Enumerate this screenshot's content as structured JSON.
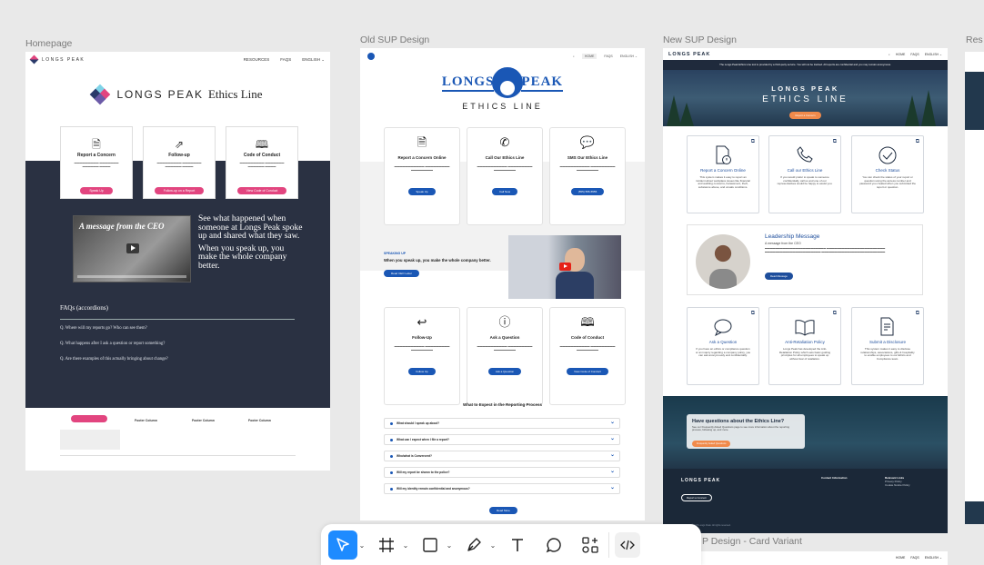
{
  "frames": {
    "homepage": {
      "label": "Homepage",
      "brand": "LONGS PEAK",
      "nav_links": [
        "RESOURCES",
        "FAQS",
        "ENGLISH ⌄"
      ],
      "title_prefix": "LONGS PEAK",
      "title_suffix": "Ethics Line",
      "cards": [
        {
          "icon": "document-icon",
          "title": "Report a Concern",
          "button": "Speak Up"
        },
        {
          "icon": "follow-up-icon",
          "title": "Follow-up",
          "button": "Follow-up on a Report"
        },
        {
          "icon": "book-icon",
          "title": "Code of Conduct",
          "button": "View Code of Conduct"
        }
      ],
      "video_title": "A message from the CEO",
      "video_text_1": "See what happened when someone at Longs Peak spoke up and shared what they saw.",
      "video_text_2": "When you speak up, you make the whole company better.",
      "faq_heading": "FAQs (accordions)",
      "faqs": [
        "Q. Where will my reports go? Who can see them?",
        "Q. What happens after I ask a question or report something?",
        "Q. Are there examples of this actually bringing about change?"
      ],
      "footer_cols": [
        "Footer Column",
        "Footer Column",
        "Footer Column"
      ]
    },
    "old_sup": {
      "label": "Old SUP Design",
      "logo_word_1": "LONGS",
      "logo_word_2": "PEAK",
      "logo_sub": "ETHICS LINE",
      "nav_links": [
        "HOME",
        "FAQS",
        "ENGLISH ⌄"
      ],
      "cards_row1": [
        {
          "icon": "document-icon",
          "title": "Report a Concern Online",
          "button": "Speak Up"
        },
        {
          "icon": "phone-icon",
          "title": "Call Our Ethics Line",
          "button": "Call Now"
        },
        {
          "icon": "sms-icon",
          "title": "SMS Our Ethics Line",
          "button": "(555) 555-5555"
        }
      ],
      "speak_kicker": "SPEAKING UP",
      "speak_heading": "When you speak up, you make the whole company better.",
      "speak_button": "Read CEO Letter",
      "cards_row2": [
        {
          "icon": "reply-icon",
          "title": "Follow-Up",
          "button": "Follow Up"
        },
        {
          "icon": "question-icon",
          "title": "Ask a Question",
          "button": "Ask a Question"
        },
        {
          "icon": "book-icon",
          "title": "Code of Conduct",
          "button": "View Code of Conduct"
        }
      ],
      "expect_heading": "What to Expect in the Reporting Process",
      "accordions": [
        "What should I speak up about?",
        "What can I expect when I file a report?",
        "Who/what is Convercent?",
        "Will my report be shown to the police?",
        "Will my identity remain confidential and anonymous?"
      ],
      "more_button": "Read More"
    },
    "new_sup": {
      "label": "New SUP Design",
      "brand": "LONGS PEAK",
      "nav_links": [
        "HOME",
        "FAQS",
        "ENGLISH ⌄"
      ],
      "notice": "The Longs Peak Ethics Line tool is provided by a third-party service. You will not be tracked. All reports are confidential and you may remain anonymous.",
      "hero_line_1": "LONGS PEAK",
      "hero_line_2": "ETHICS LINE",
      "hero_button": "Report a Concern",
      "cards_row1": [
        {
          "icon": "report-icon",
          "title": "Report a Concern Online",
          "desc": "This system makes it easy to report an incident about workplace issues like financial and auditing concerns, harassment, theft, substance abuse, and unsafe conditions."
        },
        {
          "icon": "phone-icon",
          "title": "Call our Ethics Line",
          "desc": "If you would prefer to speak to someone confidentially, call us and one of our representatives would be happy to assist you."
        },
        {
          "icon": "check-icon",
          "title": "Check Status",
          "desc": "You can check the status of your report or question using the access number and password you created when you submitted the report or question."
        }
      ],
      "leadership_heading": "Leadership Message",
      "leadership_sub": "A message from the CEO",
      "leadership_button": "Read Message",
      "cards_row2": [
        {
          "icon": "chat-icon",
          "title": "Ask a Question",
          "desc": "If you have an ethics or compliance question or an inquiry regarding a company policy, you can ask anonymously and confidentially."
        },
        {
          "icon": "book-icon",
          "title": "Anti-Retaliation Policy",
          "desc": "Longs Peak has developed the Anti-Retaliation Policy which sets basic guiding principles for all employees to speak up without fear of retaliation."
        },
        {
          "icon": "disclosure-icon",
          "title": "Submit a Disclosure",
          "desc": "This system makes it easy to disclose relationships, associations, gifts & hospitality to enable employees to our Ethics and Compliance team."
        }
      ],
      "faq_box_heading": "Have questions about the Ethics Line?",
      "faq_box_sub": "See our Frequently Asked Questions page to see more information about the reporting process, following up, and more.",
      "faq_box_button": "Frequently Asked Questions",
      "footer_brand": "LONGS PEAK",
      "footer_button": "Report a Concern",
      "footer_col_1_head": "Contact Information",
      "footer_col_2_head": "Relevant Links",
      "footer_links": [
        "Privacy Policy",
        "Cookie Notice Policy"
      ],
      "copyright": "Copyright ©2025 Longs Peak. All rights reserved."
    },
    "res": {
      "label": "Res"
    },
    "card_variant": {
      "label": "P Design - Card Variant",
      "nav_links": [
        "HOME",
        "FAQS",
        "ENGLISH ⌄"
      ]
    }
  },
  "toolbar": {
    "tools": [
      "move-tool",
      "frame-tool",
      "shape-tool",
      "pen-tool",
      "text-tool",
      "comment-tool",
      "actions-tool",
      "dev-mode-toggle"
    ],
    "active_tool": "move-tool",
    "accent": "#1e8bff"
  },
  "colors": {
    "homepage_accent": "#e2457f",
    "homepage_dark": "#2a3142",
    "old_sup_blue": "#1a57b5",
    "new_sup_blue": "#1e4e9c",
    "new_sup_orange": "#f08a4b"
  }
}
